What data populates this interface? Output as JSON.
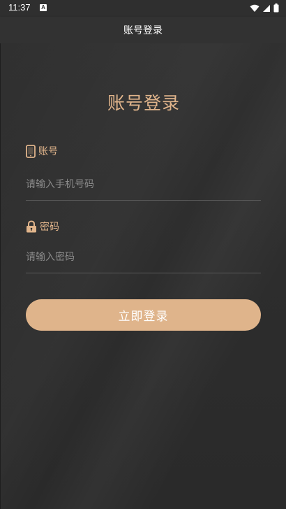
{
  "status_bar": {
    "time": "11:37",
    "notification_badge": "A",
    "icons": [
      "wifi-icon",
      "signal-icon",
      "battery-icon"
    ]
  },
  "app_bar": {
    "title": "账号登录"
  },
  "login": {
    "heading": "账号登录",
    "account": {
      "label": "账号",
      "icon": "phone-icon",
      "placeholder": "请输入手机号码"
    },
    "password": {
      "label": "密码",
      "icon": "lock-icon",
      "placeholder": "请输入密码"
    },
    "submit_label": "立即登录"
  },
  "colors": {
    "accent": "#e0b48b",
    "button": "#dfb48b",
    "background": "#2b2b2b",
    "divider": "#5a5a5a",
    "placeholder": "#8a8a8a"
  }
}
